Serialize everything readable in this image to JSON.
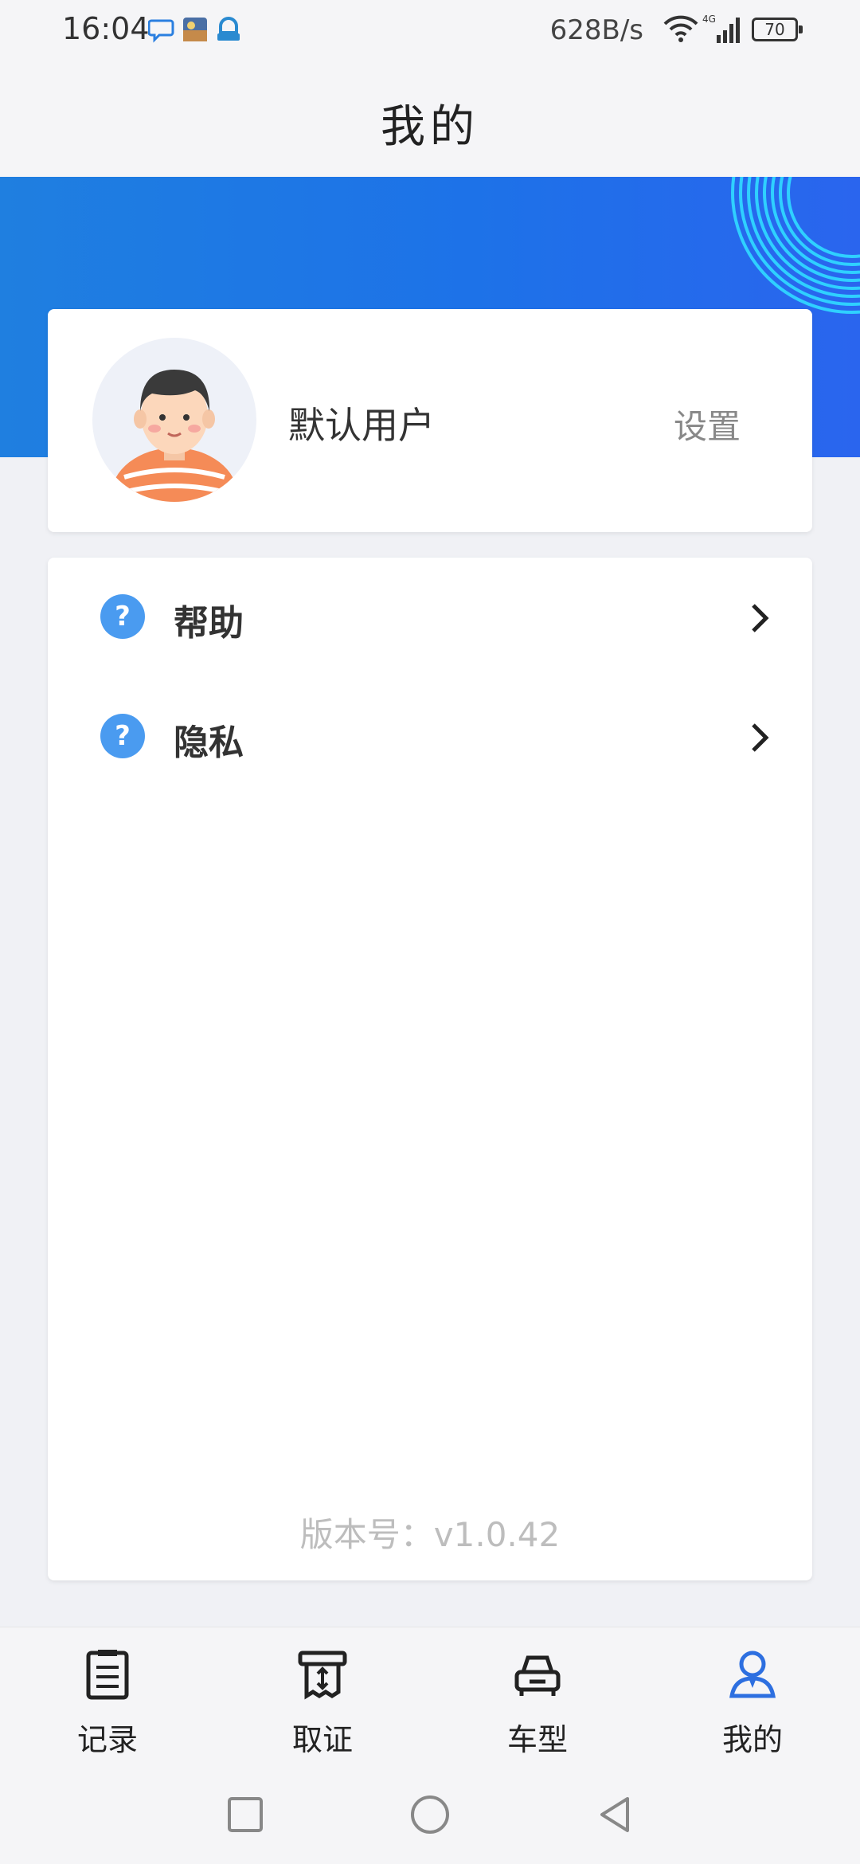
{
  "status_bar": {
    "time": "16:04",
    "network_speed": "628B/s",
    "network_type": "4G",
    "battery": "70",
    "notification_icons": [
      "chat-bubble-icon",
      "game-app-icon",
      "shield-app-icon"
    ]
  },
  "header": {
    "title": "我的"
  },
  "profile": {
    "user_name": "默认用户",
    "settings_label": "设置",
    "avatar_icon": "user-avatar"
  },
  "menu": {
    "items": [
      {
        "label": "帮助",
        "icon": "question-icon"
      },
      {
        "label": "隐私",
        "icon": "question-icon"
      }
    ]
  },
  "version_label": "版本号：v1.0.42",
  "bottom_nav": {
    "items": [
      {
        "label": "记录",
        "icon": "clipboard-icon"
      },
      {
        "label": "取证",
        "icon": "evidence-icon"
      },
      {
        "label": "车型",
        "icon": "car-icon"
      },
      {
        "label": "我的",
        "icon": "user-icon",
        "active": true
      }
    ]
  },
  "colors": {
    "accent": "#1e74e6",
    "menu_icon": "#4a9bf0",
    "active_nav": "#2d6fe0"
  }
}
